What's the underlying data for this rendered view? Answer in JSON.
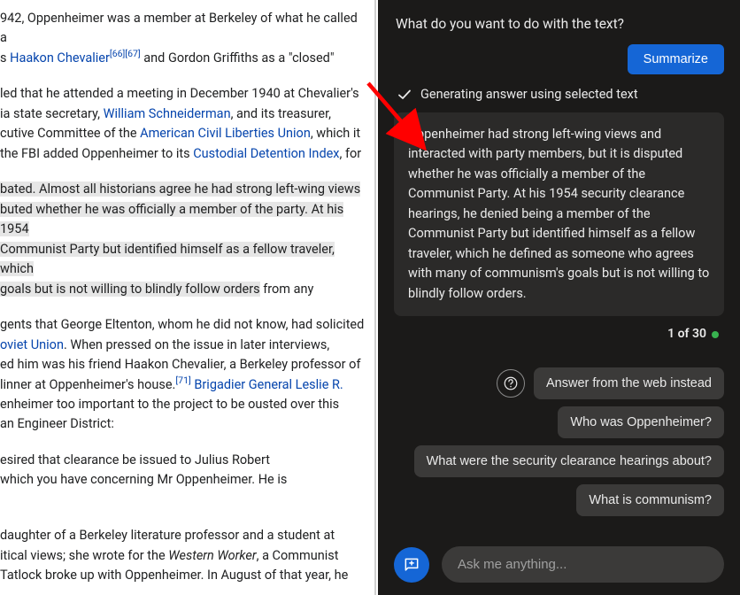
{
  "article": {
    "p1_a": "942, Oppenheimer was a member at Berkeley of what he called a ",
    "p1_link1": "Haakon Chevalier",
    "p1_ref1": "[66]",
    "p1_ref2": "[67]",
    "p1_b": " and Gordon Griffiths as a \"closed\" ",
    "p2_a": "led that he attended a meeting in December 1940 at Chevalier's ",
    "p2_b": "ia state secretary, ",
    "p2_link1": "William Schneiderman",
    "p2_c": ", and its treasurer, ",
    "p2_d": "cutive Committee of the ",
    "p2_link2": "American Civil Liberties Union",
    "p2_e": ", which it ",
    "p2_f": "the FBI added Oppenheimer to its ",
    "p2_link3": "Custodial Detention Index",
    "p2_g": ", for ",
    "p3_a": "bated. Almost all historians agree he had strong left-wing views ",
    "p3_b": "buted whether he was officially a member of the party. At his 1954 ",
    "p3_c": "Communist Party but identified himself as a fellow traveler, which ",
    "p3_d": " goals but is not willing to blindly follow orders",
    "p3_e": " from any ",
    "p4_a": "gents that George Eltenton, whom he did not know, had solicited ",
    "p4_link1": "oviet Union",
    "p4_b": ". When pressed on the issue in later interviews, ",
    "p4_c": "ed him was his friend Haakon Chevalier, a Berkeley professor of ",
    "p4_d": "linner at Oppenheimer's house.",
    "p4_ref1": "[71]",
    "p4_link2": " Brigadier General Leslie R. ",
    "p4_e": "enheimer too important to the project to be ousted over this ",
    "p4_f": "an Engineer District:",
    "p5_a": "esired that clearance be issued to Julius Robert ",
    "p5_b": " which you have concerning Mr Oppenheimer. He is ",
    "p6_a": "daughter of a Berkeley literature professor and a student at ",
    "p6_b": "itical views; she wrote for the ",
    "p6_em": "Western Worker",
    "p6_c": ", a Communist ",
    "p6_d": "Tatlock broke up with Oppenheimer. In August of that year, he "
  },
  "panel": {
    "header_prompt": "What do you want to do with the text?",
    "summarize_label": "Summarize",
    "status_text": "Generating answer using selected text",
    "answer": "Oppenheimer had strong left-wing views and interacted with party members, but it is disputed whether he was officially a member of the Communist Party. At his 1954 security clearance hearings, he denied being a member of the Communist Party but identified himself as a fellow traveler, which he defined as someone who agrees with many of communism's goals but is not willing to blindly follow orders.",
    "pager_label": "1 of 30",
    "suggestions": [
      "Answer from the web instead",
      "Who was Oppenheimer?",
      "What were the security clearance hearings about?",
      "What is communism?"
    ],
    "input_placeholder": "Ask me anything..."
  }
}
